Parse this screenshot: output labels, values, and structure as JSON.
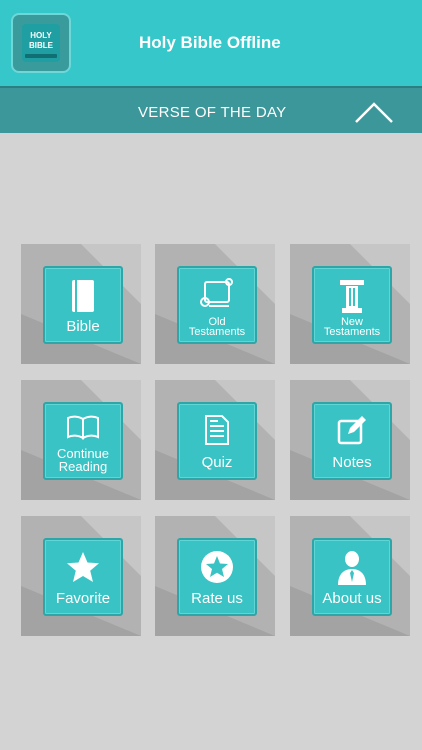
{
  "app_bar": {
    "icon_text": "HOLY\nBIBLE",
    "title": "Holy Bible Offline",
    "color": "#35c7c9"
  },
  "verse_bar": {
    "title": "VERSE OF THE DAY",
    "toggle_icon": "chevron-up-icon",
    "color": "#3b9799"
  },
  "menu": {
    "items": [
      {
        "label": "Bible",
        "icon": "book-icon"
      },
      {
        "label": "Old\nTestaments",
        "icon": "scroll-icon"
      },
      {
        "label": "New\nTestaments",
        "icon": "pillar-icon"
      },
      {
        "label": "Continue\nReading",
        "icon": "open-book-icon"
      },
      {
        "label": "Quiz",
        "icon": "document-icon"
      },
      {
        "label": "Notes",
        "icon": "edit-icon"
      },
      {
        "label": "Favorite",
        "icon": "star-icon"
      },
      {
        "label": "Rate us",
        "icon": "star-circle-icon"
      },
      {
        "label": "About us",
        "icon": "person-icon"
      }
    ],
    "button_color": "#3ac3c4",
    "tile_color": "#b2b2b2"
  }
}
